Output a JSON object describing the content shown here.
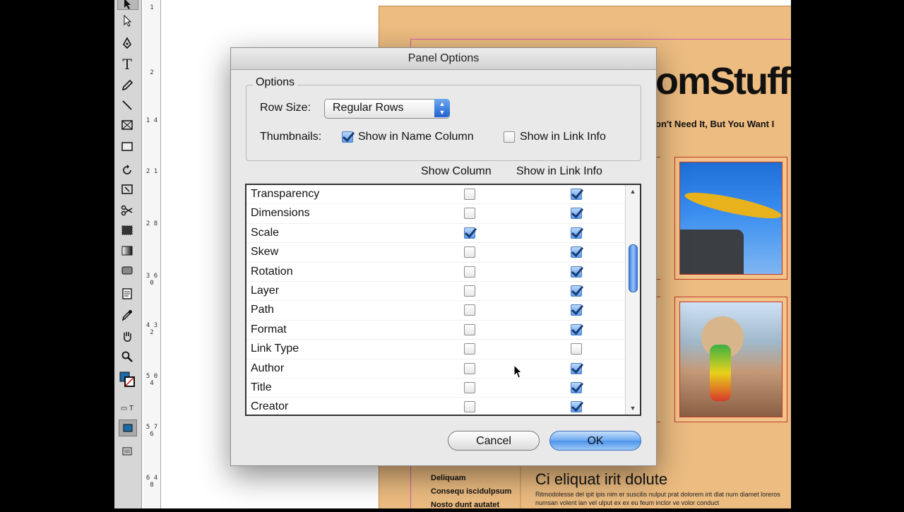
{
  "dialog": {
    "title": "Panel Options",
    "options_group_label": "Options",
    "row_size_label": "Row Size:",
    "row_size_value": "Regular Rows",
    "thumbnails_label": "Thumbnails:",
    "thumb_name_column": {
      "label": "Show in Name Column",
      "checked": true
    },
    "thumb_link_info": {
      "label": "Show in Link Info",
      "checked": false
    },
    "col_show_column": "Show Column",
    "col_show_link_info": "Show in Link Info",
    "rows": [
      {
        "label": "Transparency",
        "show_column": false,
        "show_link_info": true
      },
      {
        "label": "Dimensions",
        "show_column": false,
        "show_link_info": true
      },
      {
        "label": "Scale",
        "show_column": true,
        "show_link_info": true
      },
      {
        "label": "Skew",
        "show_column": false,
        "show_link_info": true
      },
      {
        "label": "Rotation",
        "show_column": false,
        "show_link_info": true
      },
      {
        "label": "Layer",
        "show_column": false,
        "show_link_info": true
      },
      {
        "label": "Path",
        "show_column": false,
        "show_link_info": true
      },
      {
        "label": "Format",
        "show_column": false,
        "show_link_info": true
      },
      {
        "label": "Link Type",
        "show_column": false,
        "show_link_info": false
      },
      {
        "label": "Author",
        "show_column": false,
        "show_link_info": true
      },
      {
        "label": "Title",
        "show_column": false,
        "show_link_info": true
      },
      {
        "label": "Creator",
        "show_column": false,
        "show_link_info": true
      }
    ],
    "cancel_label": "Cancel",
    "ok_label": "OK"
  },
  "ruler": {
    "marks": [
      "1",
      "2",
      "1 4",
      "2 1",
      "2 8",
      "3 6 0",
      "4 3 2",
      "5 0 4",
      "5 7 6",
      "6 4 8"
    ]
  },
  "document": {
    "brand": "omStuff",
    "tagline": "on't Need It, But You Want I",
    "bottom_left_lines": [
      "Deliquam",
      "Consequ iscidulpsum",
      "Nosto dunt autatet"
    ],
    "bottom_heading": "Ci eliquat irit dolute",
    "bottom_body": "Ritmodolesse del ipit ipis nim er suscilis nulput prat dolorem irit dlat num diamet loreros numsan volent lan vel ulput ex ex eu feum inclor ve volor conduct"
  },
  "colors": {
    "page": "#ecbc81",
    "accent_blue": "#4c93ea",
    "frame_red": "#c0392b"
  }
}
